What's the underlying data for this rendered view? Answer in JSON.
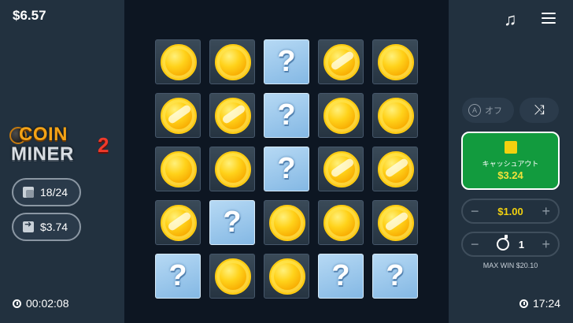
{
  "header": {
    "balance": "$6.57"
  },
  "logo": {
    "line1": "COIN",
    "line2": "MINER",
    "number": "2"
  },
  "stats": {
    "tiles": "18/24",
    "payout": "$3.74"
  },
  "timer": {
    "elapsed": "00:02:08",
    "clock": "17:24"
  },
  "controls": {
    "auto_label": "オフ",
    "cashout_label": "キャッシュアウト",
    "cashout_amount": "$3.24",
    "bet_value": "$1.00",
    "minus": "−",
    "plus": "+",
    "mines_value": "1",
    "max_win": "MAX WIN $20.10"
  },
  "grid": {
    "rows": [
      [
        "coin",
        "coin",
        "mystery",
        "coin-shiny",
        "coin"
      ],
      [
        "coin-shiny",
        "coin-shiny",
        "mystery",
        "coin",
        "coin"
      ],
      [
        "coin",
        "coin",
        "mystery",
        "coin-shiny",
        "coin-shiny"
      ],
      [
        "coin-shiny",
        "mystery",
        "coin",
        "coin",
        "coin-shiny"
      ],
      [
        "mystery",
        "coin",
        "coin",
        "mystery",
        "mystery"
      ]
    ],
    "mystery_symbol": "?"
  },
  "colors": {
    "panel": "#22313f",
    "board": "#0d1622",
    "cashout": "#129b3e",
    "gold": "#f2d10f",
    "mystery_tile": "#a3cdee"
  },
  "icons": [
    "music-icon",
    "menu-icon",
    "tiles-icon",
    "exit-icon",
    "clock-icon",
    "shuffle-icon",
    "auto-icon",
    "mine-icon"
  ]
}
